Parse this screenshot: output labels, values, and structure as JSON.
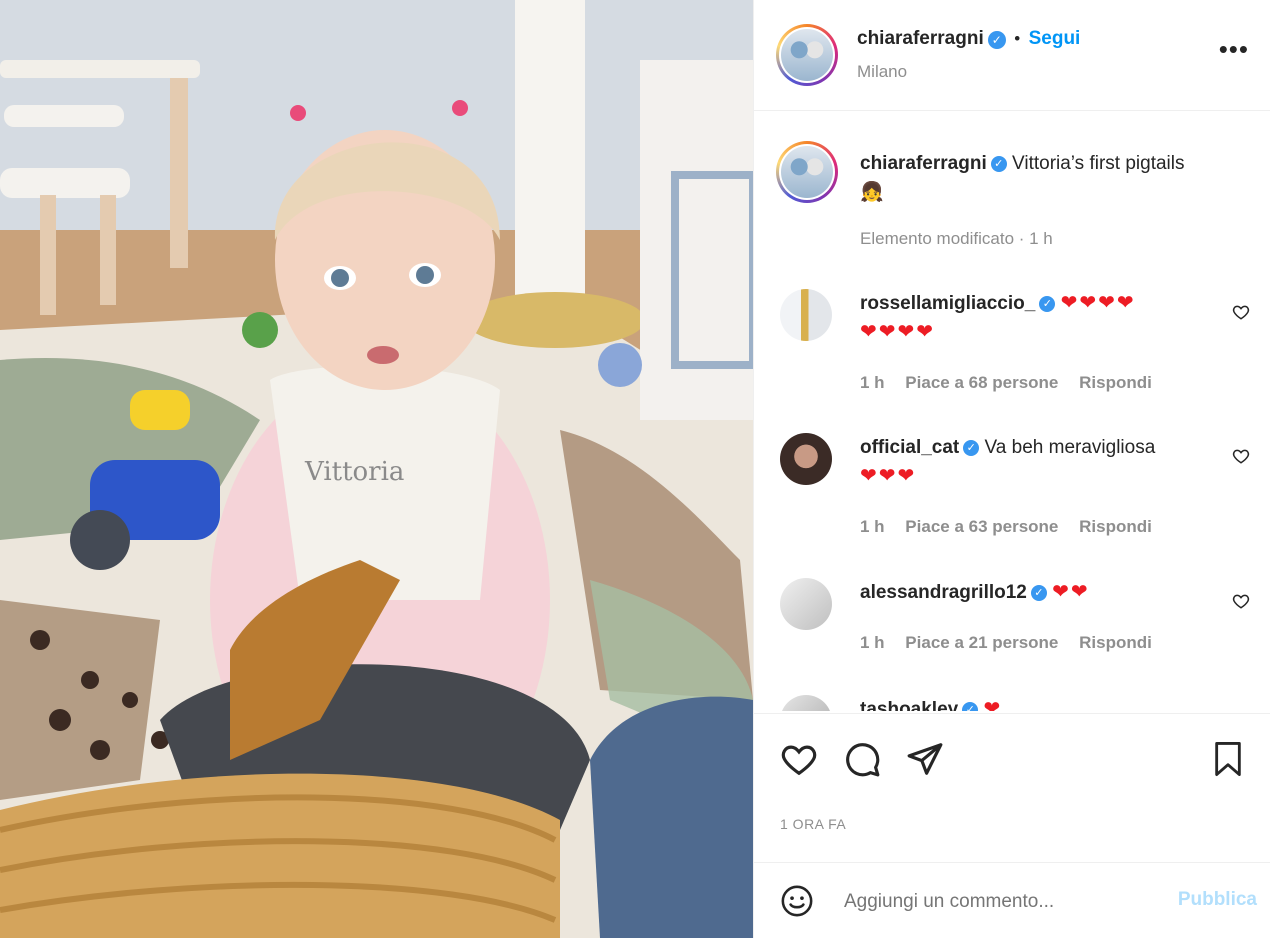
{
  "post": {
    "username": "chiaraferragni",
    "location": "Milano",
    "follow_label": "Segui",
    "separator": "•",
    "more_icon": "more-options-icon",
    "caption_text": "Vittoria’s first pigtails",
    "caption_emoji": "👧",
    "caption_meta": "Elemento modificato · 1 h"
  },
  "comments": [
    {
      "user": "rossellamigliaccio_",
      "text_line1": "❤❤❤❤",
      "text_line2": "❤❤❤❤",
      "time": "1 h",
      "likes": "Piace a 68 persone",
      "reply": "Rispondi"
    },
    {
      "user": "official_cat",
      "text_line1": "Va beh meravigliosa",
      "text_line2": "❤❤❤",
      "time": "1 h",
      "likes": "Piace a 63 persone",
      "reply": "Rispondi"
    },
    {
      "user": "alessandragrillo12",
      "text_line1": "❤❤",
      "text_line2": "",
      "time": "1 h",
      "likes": "Piace a 21 persone",
      "reply": "Rispondi"
    },
    {
      "user": "tashoakley",
      "text_line1": "❤",
      "text_line2": "",
      "time": "",
      "likes": "",
      "reply": ""
    }
  ],
  "actions": {
    "like_icon": "heart-icon",
    "comment_icon": "comment-icon",
    "share_icon": "share-icon",
    "save_icon": "bookmark-icon",
    "timestamp": "1 ORA FA"
  },
  "add_comment": {
    "emoji_icon": "emoji-icon",
    "placeholder": "Aggiungi un commento...",
    "publish_label": "Pubblica"
  },
  "photo": {
    "bib_text": "Vittoria"
  },
  "colors": {
    "accent": "#0095f6",
    "verified": "#3897f0",
    "heart": "#ed1c24",
    "muted": "#8e8e8e"
  }
}
